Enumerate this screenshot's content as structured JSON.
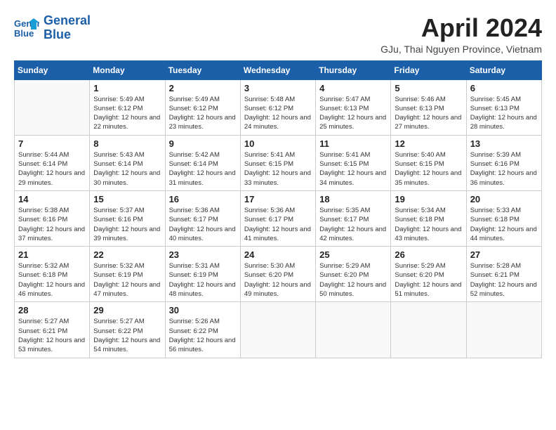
{
  "header": {
    "logo_line1": "General",
    "logo_line2": "Blue",
    "month_title": "April 2024",
    "subtitle": "GJu, Thai Nguyen Province, Vietnam"
  },
  "weekdays": [
    "Sunday",
    "Monday",
    "Tuesday",
    "Wednesday",
    "Thursday",
    "Friday",
    "Saturday"
  ],
  "weeks": [
    [
      {
        "day": "",
        "info": ""
      },
      {
        "day": "1",
        "info": "Sunrise: 5:49 AM\nSunset: 6:12 PM\nDaylight: 12 hours\nand 22 minutes."
      },
      {
        "day": "2",
        "info": "Sunrise: 5:49 AM\nSunset: 6:12 PM\nDaylight: 12 hours\nand 23 minutes."
      },
      {
        "day": "3",
        "info": "Sunrise: 5:48 AM\nSunset: 6:12 PM\nDaylight: 12 hours\nand 24 minutes."
      },
      {
        "day": "4",
        "info": "Sunrise: 5:47 AM\nSunset: 6:13 PM\nDaylight: 12 hours\nand 25 minutes."
      },
      {
        "day": "5",
        "info": "Sunrise: 5:46 AM\nSunset: 6:13 PM\nDaylight: 12 hours\nand 27 minutes."
      },
      {
        "day": "6",
        "info": "Sunrise: 5:45 AM\nSunset: 6:13 PM\nDaylight: 12 hours\nand 28 minutes."
      }
    ],
    [
      {
        "day": "7",
        "info": "Sunrise: 5:44 AM\nSunset: 6:14 PM\nDaylight: 12 hours\nand 29 minutes."
      },
      {
        "day": "8",
        "info": "Sunrise: 5:43 AM\nSunset: 6:14 PM\nDaylight: 12 hours\nand 30 minutes."
      },
      {
        "day": "9",
        "info": "Sunrise: 5:42 AM\nSunset: 6:14 PM\nDaylight: 12 hours\nand 31 minutes."
      },
      {
        "day": "10",
        "info": "Sunrise: 5:41 AM\nSunset: 6:15 PM\nDaylight: 12 hours\nand 33 minutes."
      },
      {
        "day": "11",
        "info": "Sunrise: 5:41 AM\nSunset: 6:15 PM\nDaylight: 12 hours\nand 34 minutes."
      },
      {
        "day": "12",
        "info": "Sunrise: 5:40 AM\nSunset: 6:15 PM\nDaylight: 12 hours\nand 35 minutes."
      },
      {
        "day": "13",
        "info": "Sunrise: 5:39 AM\nSunset: 6:16 PM\nDaylight: 12 hours\nand 36 minutes."
      }
    ],
    [
      {
        "day": "14",
        "info": "Sunrise: 5:38 AM\nSunset: 6:16 PM\nDaylight: 12 hours\nand 37 minutes."
      },
      {
        "day": "15",
        "info": "Sunrise: 5:37 AM\nSunset: 6:16 PM\nDaylight: 12 hours\nand 39 minutes."
      },
      {
        "day": "16",
        "info": "Sunrise: 5:36 AM\nSunset: 6:17 PM\nDaylight: 12 hours\nand 40 minutes."
      },
      {
        "day": "17",
        "info": "Sunrise: 5:36 AM\nSunset: 6:17 PM\nDaylight: 12 hours\nand 41 minutes."
      },
      {
        "day": "18",
        "info": "Sunrise: 5:35 AM\nSunset: 6:17 PM\nDaylight: 12 hours\nand 42 minutes."
      },
      {
        "day": "19",
        "info": "Sunrise: 5:34 AM\nSunset: 6:18 PM\nDaylight: 12 hours\nand 43 minutes."
      },
      {
        "day": "20",
        "info": "Sunrise: 5:33 AM\nSunset: 6:18 PM\nDaylight: 12 hours\nand 44 minutes."
      }
    ],
    [
      {
        "day": "21",
        "info": "Sunrise: 5:32 AM\nSunset: 6:18 PM\nDaylight: 12 hours\nand 46 minutes."
      },
      {
        "day": "22",
        "info": "Sunrise: 5:32 AM\nSunset: 6:19 PM\nDaylight: 12 hours\nand 47 minutes."
      },
      {
        "day": "23",
        "info": "Sunrise: 5:31 AM\nSunset: 6:19 PM\nDaylight: 12 hours\nand 48 minutes."
      },
      {
        "day": "24",
        "info": "Sunrise: 5:30 AM\nSunset: 6:20 PM\nDaylight: 12 hours\nand 49 minutes."
      },
      {
        "day": "25",
        "info": "Sunrise: 5:29 AM\nSunset: 6:20 PM\nDaylight: 12 hours\nand 50 minutes."
      },
      {
        "day": "26",
        "info": "Sunrise: 5:29 AM\nSunset: 6:20 PM\nDaylight: 12 hours\nand 51 minutes."
      },
      {
        "day": "27",
        "info": "Sunrise: 5:28 AM\nSunset: 6:21 PM\nDaylight: 12 hours\nand 52 minutes."
      }
    ],
    [
      {
        "day": "28",
        "info": "Sunrise: 5:27 AM\nSunset: 6:21 PM\nDaylight: 12 hours\nand 53 minutes."
      },
      {
        "day": "29",
        "info": "Sunrise: 5:27 AM\nSunset: 6:22 PM\nDaylight: 12 hours\nand 54 minutes."
      },
      {
        "day": "30",
        "info": "Sunrise: 5:26 AM\nSunset: 6:22 PM\nDaylight: 12 hours\nand 56 minutes."
      },
      {
        "day": "",
        "info": ""
      },
      {
        "day": "",
        "info": ""
      },
      {
        "day": "",
        "info": ""
      },
      {
        "day": "",
        "info": ""
      }
    ]
  ]
}
